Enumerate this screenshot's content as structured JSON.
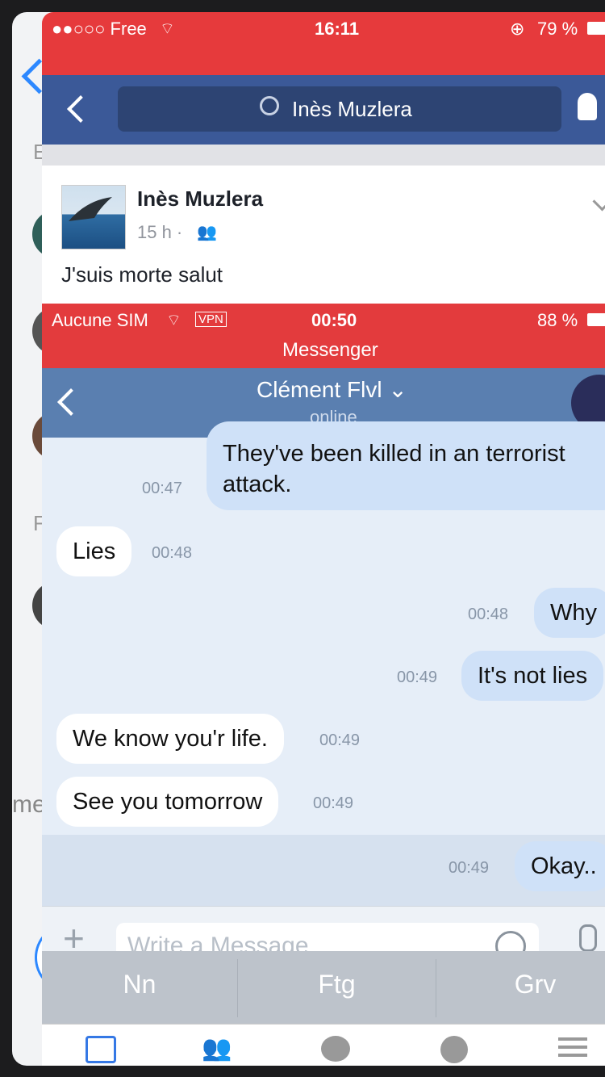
{
  "background_screen": {
    "letters": [
      "E",
      "F"
    ],
    "fragment": "me"
  },
  "fb": {
    "status": {
      "carrier": "●●○○○ Free",
      "time": "16:11",
      "battery": "79 %"
    },
    "search_text": "Inès Muzlera",
    "post": {
      "author": "Inès Muzlera",
      "meta": "15 h ·",
      "text": "J'suis morte salut"
    }
  },
  "messenger": {
    "status": {
      "carrier": "Aucune SIM",
      "vpn": "VPN",
      "time": "00:50",
      "battery": "88 %",
      "app": "Messenger"
    },
    "header": {
      "name": "Clément Flvl ⌄",
      "presence": "online"
    },
    "messages": [
      {
        "text1": "They've been killed in an terrorist",
        "text2": "attack.",
        "time": "00:47"
      },
      {
        "text": "Lies",
        "time": "00:48"
      },
      {
        "text": "Why",
        "time": "00:48"
      },
      {
        "text": "It's not lies",
        "time": "00:49"
      },
      {
        "text": "We know you'r life.",
        "time": "00:49"
      },
      {
        "text": "See you tomorrow",
        "time": "00:49"
      },
      {
        "text": "Okay..",
        "time": "00:49"
      }
    ],
    "input_placeholder": "Write a Message",
    "suggestions": [
      "Nn",
      "Ftg",
      "Grv"
    ]
  }
}
